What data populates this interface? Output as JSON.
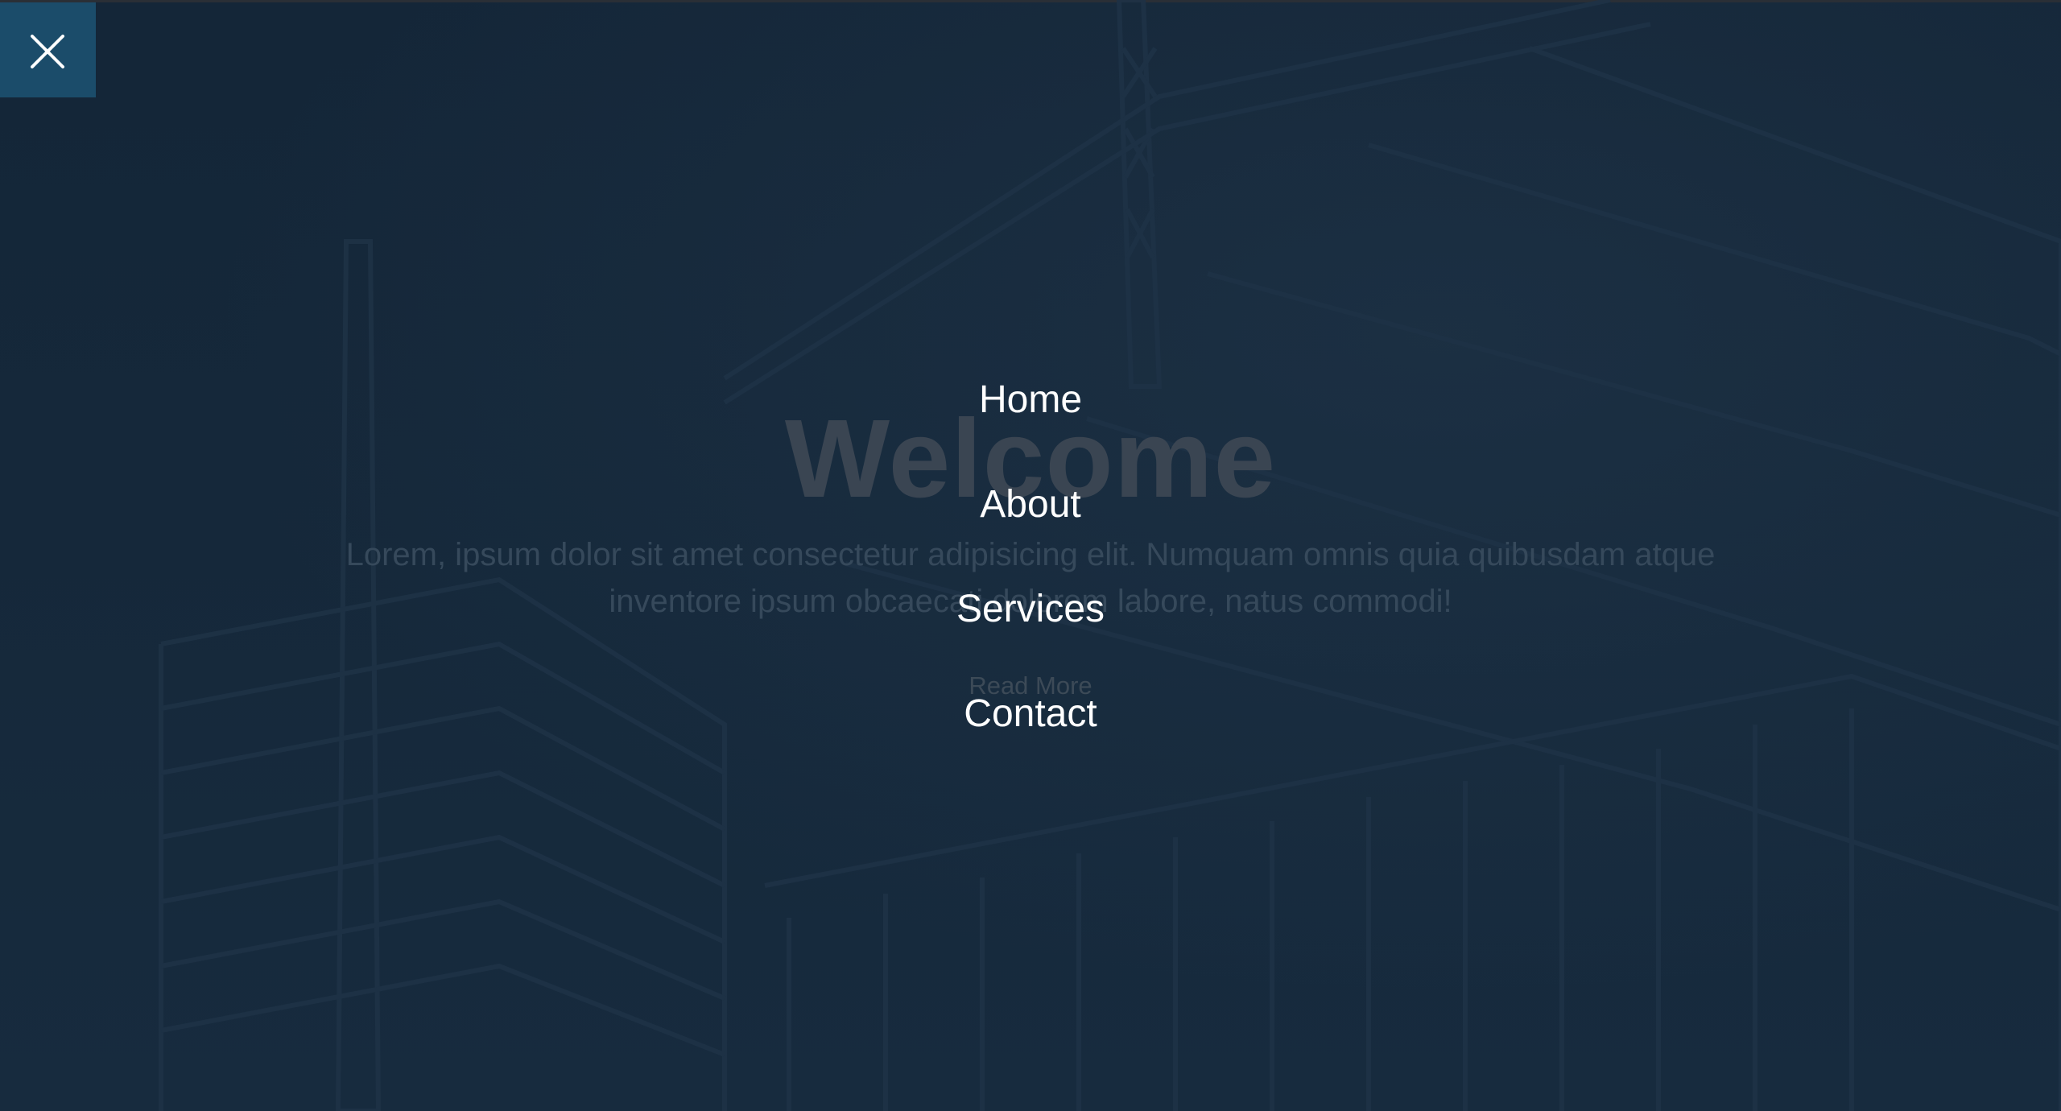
{
  "hero": {
    "title": "Welcome",
    "text": "Lorem, ipsum dolor sit amet consectetur adipisicing elit. Numquam omnis quia quibusdam atque inventore ipsum obcaecati dolorem labore, natus commodi!",
    "button_label": "Read More"
  },
  "menu": {
    "close_icon": "close-icon",
    "items": [
      {
        "label": "Home"
      },
      {
        "label": "About"
      },
      {
        "label": "Services"
      },
      {
        "label": "Contact"
      }
    ]
  },
  "colors": {
    "overlay_background": "#15283a",
    "close_button_background": "#1b4c6a",
    "menu_text": "#ffffff"
  }
}
